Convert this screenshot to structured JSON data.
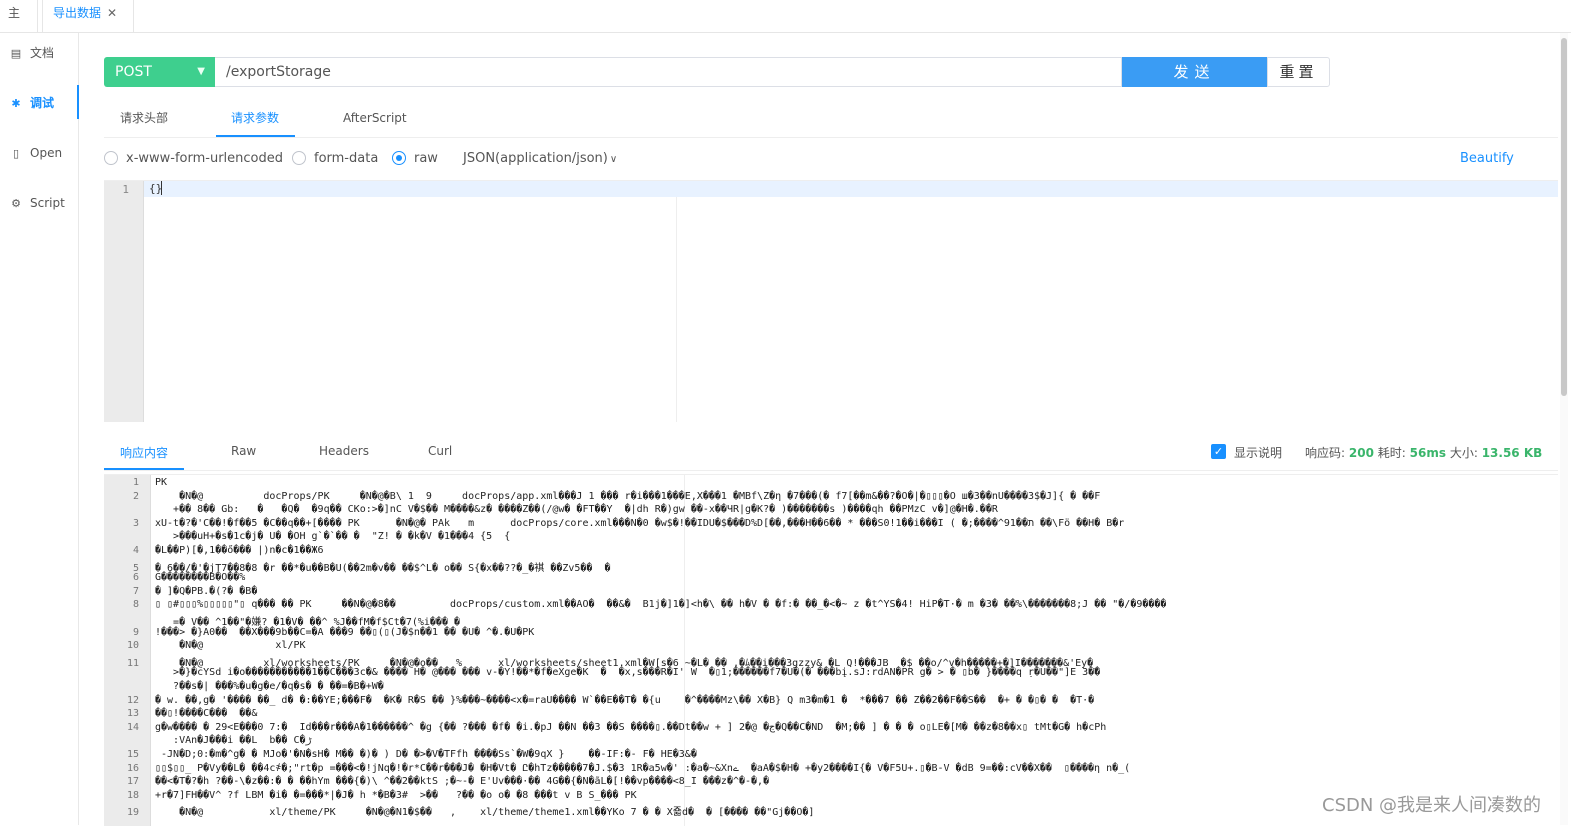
{
  "tabs": [
    {
      "label": "主页"
    },
    {
      "label": "导出数据",
      "close": "✕"
    }
  ],
  "sidebar": {
    "items": [
      {
        "icon": "document-icon",
        "glyph": "▤",
        "label": "文档"
      },
      {
        "icon": "bug-icon",
        "glyph": "✱",
        "label": "调试"
      },
      {
        "icon": "file-icon",
        "glyph": "▯",
        "label": "Open"
      },
      {
        "icon": "gear-icon",
        "glyph": "⚙",
        "label": "Script"
      }
    ]
  },
  "request": {
    "method": "POST",
    "url": "/exportStorage",
    "send_label": "发送",
    "reset_label": "重置"
  },
  "request_tabs": [
    "请求头部",
    "请求参数",
    "AfterScript"
  ],
  "body_types": {
    "urlencoded": "x-www-form-urlencoded",
    "formdata": "form-data",
    "raw": "raw",
    "content_type": "JSON(application/json)",
    "beautify": "Beautify"
  },
  "editor": {
    "line_number": "1",
    "content": "{}"
  },
  "response_tabs": [
    "响应内容",
    "Raw",
    "Headers",
    "Curl"
  ],
  "response_status": {
    "show_desc_label": "显示说明",
    "code_label": "响应码:",
    "code": "200",
    "time_label": "耗时:",
    "time": "56ms",
    "size_label": "大小:",
    "size": "13.56 KB"
  },
  "response_lines": [
    {
      "n": "1",
      "text": "PK"
    },
    {
      "n": "2",
      "text": "    �N�@          docProps/PK     �N�@�B\\ 1  9     docProps/app.xml���J 1 ��� r�i���1���E,X���1 �MBf\\Z�η �7���(� f7[��m&��?�O�|�▯▯▯�O ш�3��nU����3$�J]{ � ��F"
    },
    {
      "n": "",
      "text": "   +�� 8�� Gb:   �   �Q�  �9q�� CKo:>�]nC V�$�� M����&z� ����Z��(/@w� �FT��Y  �|dh R�)gw ��-x��ЧR|g�K?� )�������s )����qh ��PMzC v�]@�H�.��R"
    },
    {
      "n": "3",
      "text": "xU-t�?�'C��!�f��5 �C��q��+[���� PK      �N�@� PAk   m      docProps/core.xml���N�0 �w$�!��IDU�$���D%D[��,���H��6�� * ���S0!1��i���I ( �;����^91��ת ��\\Fö ��H� B�r"
    },
    {
      "n": "",
      "text": "   >���uH+�s�1c�j� U� �OH g`�`�� �  \"Z! � �k�V �1���4 {5  {"
    },
    {
      "n": "4",
      "text": "�L��P)[�,1��ő��� |)n�c�1��Ж6"
    },
    {
      "n": "5",
      "text": "� 6��/�'�jT7��8�8 �r ��*�u��B�U(��2m�v�� ��$^L� o�� S{�x��??�_�褀 ��Zv5��  �"
    },
    {
      "n": "6",
      "text": "G��������B�O��%"
    },
    {
      "n": "7",
      "text": "� ]�Q�PB.�(?� �B�"
    },
    {
      "n": "8",
      "text": "▯ ▯#▯▯▯%▯▯▯▯▯\"▯ q��� �� PK     ��N�@�8��         docProps/custom.xml��AO�  ��&�  B1j�]1�]<h�\\ �� h�V � �f:� ��_�<�~ z �t^YS�4! HiP�T·� m �3� ��%\\�������8;J �� \"�/�9����"
    },
    {
      "n": "",
      "text": "   =� V�� ^1��\"�嫌? �1�V� ��^ %J��fM�f$Ct�7(%i��� �"
    },
    {
      "n": "9",
      "text": "!���> �}A0��  ��X���9b��C=�A ���9 ��▯(▯(J�$n��1 �� �U� ^�.�U�PK"
    },
    {
      "n": "10",
      "text": "    �N�@            xl/PK"
    },
    {
      "n": "11",
      "text": "    �N�@          xl/worksheets/PK     �N�@�o��   %      xl/worksheets/sheet1.xml�W[s�6 ~�L� �� ,�ﾑ��i���3gzzy& �L Q!���JB  �$ ��o/^v�h�����+�]I�������&'Ey�_"
    },
    {
      "n": "",
      "text": "   >�}�cYSd i�o�����������1��C���3c�& ���� H� @��� ��� v-�Y!��*�f�eXge�K  �  �x,s���R�I' W  �▯1;������f7�U�(� ���bį.sJ:rdAN�PR g� > � ▯b� }����q ṛ�U��\"]E 3��"
    },
    {
      "n": "",
      "text": "   ?��s�| ���%�u�g�e/�q�s� � ��=�B�+W�"
    },
    {
      "n": "12",
      "text": "� w. ��,g� '���� ��_ d� �:��YE;���F�  �K� R�S �� }%���~����<x�=raU���� W`��E��T� �{u    �^����Mz\\�� X�B} Q m3�m�1 �  *���7 �� Z��2��F��S��  �+ � �▯� �  �T·�"
    },
    {
      "n": "13",
      "text": "��▯!����C���  ��&"
    },
    {
      "n": "14",
      "text": "g�w���� � 29<E���0 7:�  Id���r���A�1������^ �g {�� ?��� �f� �i.�pJ ��N ��3 ��S ����▯.��Dt��w + ] 2�@ �ڃ�Q��C�ND  �M;�� ] � � � o▯LE�[M� ��z�8��x▯ tMt�G� h�cPh"
    },
    {
      "n": "",
      "text": "   :VAn�J���i ��L  b�� C�ڑ"
    },
    {
      "n": "15",
      "text": " -JN�D;0:�m�^g� � MJo�'�N�sH� M�� �)� ) D� �>�V�TFfh ����Ss`�W�9qX }    ��-IF:�- F� HE�3&�"
    },
    {
      "n": "16",
      "text": "▯▯$▯▯_ P�Vy��L� ��4c҂�;\"rt�p =���<�!jNq�!�r*C��r���J� �H�Vt� Ը�hTz�����7�J.$�3 1R�a5w�' :�a�~&Xnے  �aA�$�H� +�y2����I{� V�F5U+.▯�B-V �dB 9=��:cV��X��  ▯����η n�_("
    },
    {
      "n": "17",
      "text": "��<�T�?�h ?��-\\�z��:� � ��hYm ���{�)\\ ^��2��ktS ;�~-� E'Uv���·�� 4G��{�N�ãL�[!��vp����<8_I ���z�^�-�,�"
    },
    {
      "n": "18",
      "text": "+r�7]FH��V^ ?f LBM �i� �=���*|�J� h *�B�3#  >��   ?�� �o o� �8 ���t v B S_��� PK"
    },
    {
      "n": "19",
      "text": "    �N�@           xl/theme/PK     �N�@�N1�$��   ,    xl/theme/theme1.xml��YKo 7 � � X죫d�  � [���� ��\"Gj��O�]"
    }
  ],
  "watermark": "CSDN @我是来人间凑数的"
}
